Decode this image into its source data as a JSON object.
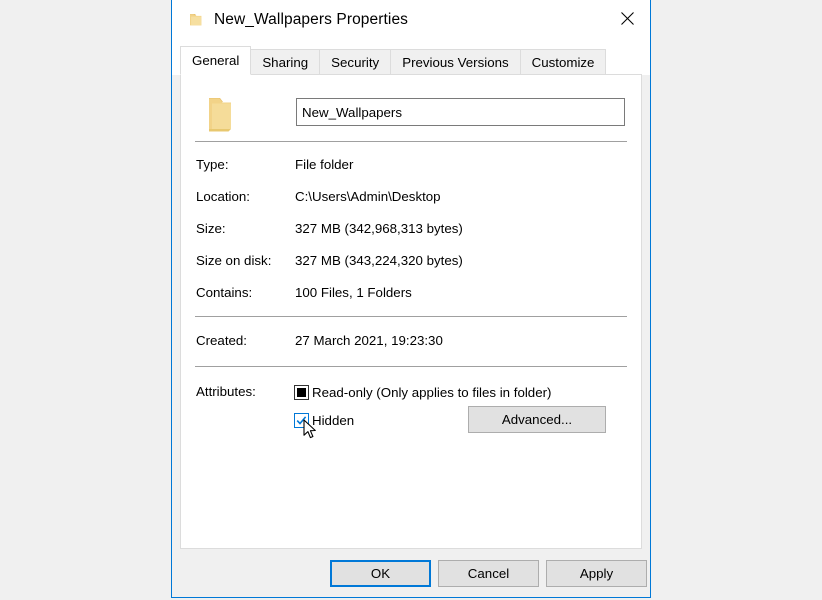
{
  "window": {
    "title": "New_Wallpapers Properties",
    "title_icon": "folder-icon",
    "close_icon": "close-icon"
  },
  "tabs": [
    {
      "label": "General",
      "active": true
    },
    {
      "label": "Sharing",
      "active": false
    },
    {
      "label": "Security",
      "active": false
    },
    {
      "label": "Previous Versions",
      "active": false
    },
    {
      "label": "Customize",
      "active": false
    }
  ],
  "general": {
    "folder_icon": "folder-icon",
    "name_value": "New_Wallpapers",
    "properties": [
      {
        "label": "Type:",
        "value": "File folder"
      },
      {
        "label": "Location:",
        "value": "C:\\Users\\Admin\\Desktop"
      },
      {
        "label": "Size:",
        "value": "327 MB (342,968,313 bytes)"
      },
      {
        "label": "Size on disk:",
        "value": "327 MB (343,224,320 bytes)"
      },
      {
        "label": "Contains:",
        "value": "100 Files, 1 Folders"
      }
    ],
    "created": {
      "label": "Created:",
      "value": "27 March 2021, 19:23:30"
    },
    "attributes": {
      "label": "Attributes:",
      "readonly": {
        "text": "Read-only (Only applies to files in folder)",
        "state": "indeterminate"
      },
      "hidden": {
        "text": "Hidden",
        "state": "checked"
      },
      "advanced_label": "Advanced..."
    }
  },
  "footer": {
    "ok_label": "OK",
    "cancel_label": "Cancel",
    "apply_label": "Apply"
  },
  "colors": {
    "accent": "#0078d7",
    "folder": "#f0d080",
    "dialog_bg": "#f0f0f0",
    "button_bg": "#e1e1e1"
  }
}
